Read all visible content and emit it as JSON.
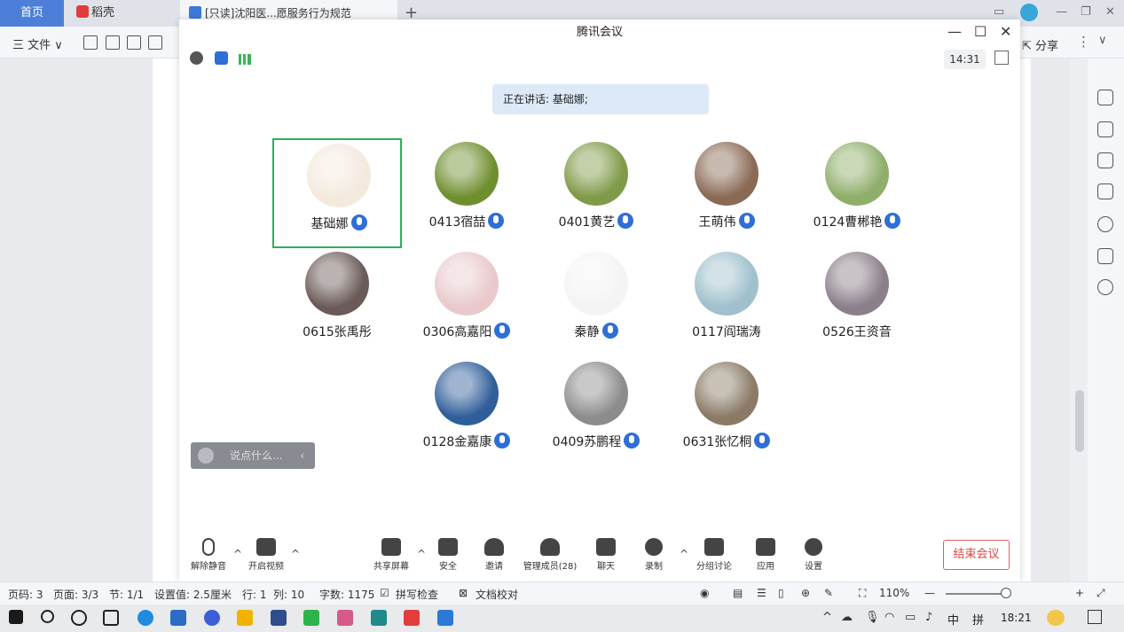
{
  "wps": {
    "tabs": {
      "home": "首页",
      "docer": "稻壳",
      "document": "[只读]沈阳医...愿服务行为规范"
    },
    "file_menu": "三 文件 ∨",
    "share": "分享",
    "status": {
      "page_code": "页码: 3",
      "pages": "页面: 3/3",
      "section": "节: 1/1",
      "setting": "设置值: 2.5厘米",
      "row": "行: 1",
      "col": "列: 10",
      "word_count": "字数: 1175",
      "spell_check": "拼写检查",
      "doc_proof": "文档校对",
      "zoom": "110%"
    }
  },
  "meeting": {
    "title": "腾讯会议",
    "clock": "14:31",
    "speaking": "正在讲话: 基础娜;",
    "chat_placeholder": "说点什么...",
    "participants": [
      {
        "name": "基础娜",
        "active": true,
        "color": "#f3e9dd"
      },
      {
        "name": "0413宿喆",
        "active": false,
        "color": "#6f8f2f"
      },
      {
        "name": "0401黄艺",
        "active": false,
        "color": "#7f9a48"
      },
      {
        "name": "王萌伟",
        "active": false,
        "color": "#8a6a55"
      },
      {
        "name": "0124曹郴艳",
        "active": false,
        "color": "#8fae6a"
      },
      {
        "name": "0615张禹彤",
        "active": false,
        "color": "#6a5a58"
      },
      {
        "name": "0306高嘉阳",
        "active": false,
        "color": "#e9c9cc"
      },
      {
        "name": "秦静",
        "active": false,
        "color": "#f4f4f4"
      },
      {
        "name": "0117阎瑞涛",
        "active": false,
        "color": "#9fc0cc"
      },
      {
        "name": "0526王资音",
        "active": false,
        "color": "#8b7f8a"
      },
      {
        "name": "0128金嘉康",
        "active": false,
        "color": "#2f5e9a"
      },
      {
        "name": "0409苏鹏程",
        "active": false,
        "color": "#8c8c8c"
      },
      {
        "name": "0631张忆桐",
        "active": false,
        "color": "#8a7a66"
      }
    ],
    "toolbar": {
      "unmute": "解除静音",
      "start_video": "开启视频",
      "share_screen": "共享屏幕",
      "security": "安全",
      "invite": "邀请",
      "manage_members": "管理成员(28)",
      "chat": "聊天",
      "record": "录制",
      "breakout": "分组讨论",
      "apps": "应用",
      "settings": "设置",
      "end_meeting": "结束会议"
    }
  },
  "taskbar": {
    "time": "18:21",
    "ime": "中",
    "ime2": "拼"
  }
}
